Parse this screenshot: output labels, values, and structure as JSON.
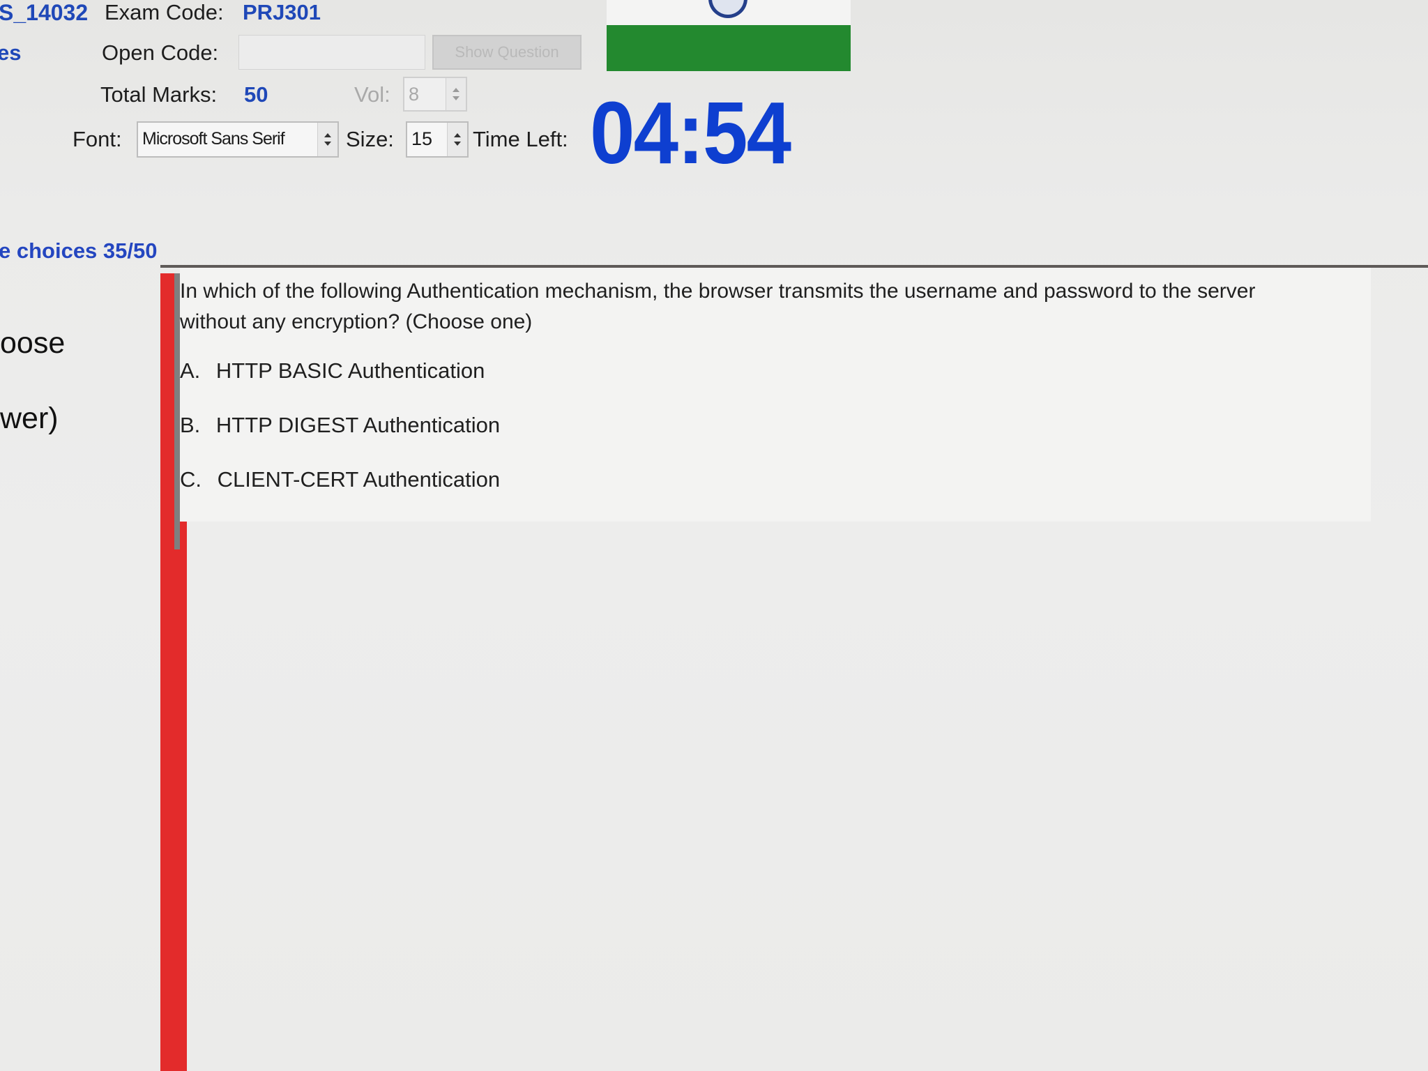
{
  "header": {
    "student_id": "S_14032",
    "exam_code_label": "Exam Code:",
    "exam_code": "PRJ301",
    "left_partial_label": "es",
    "open_code_label": "Open Code:",
    "open_code_value": "",
    "show_question_button": "Show Question",
    "total_marks_label": "Total Marks:",
    "total_marks": "50",
    "vol_label": "Vol:",
    "vol_value": "8",
    "font_label": "Font:",
    "font_value": "Microsoft Sans Serif",
    "size_label": "Size:",
    "size_value": "15",
    "time_left_label": "Time Left:",
    "time_left": "04:54"
  },
  "progress": {
    "text": "e choices 35/50"
  },
  "sidebar": {
    "line1": "oose",
    "line2": "wer)"
  },
  "question": {
    "text": "In which of the following Authentication mechanism, the browser transmits the username and password to the server without any encryption? (Choose one)",
    "options": [
      {
        "letter": "A.",
        "text": "HTTP BASIC Authentication"
      },
      {
        "letter": "B.",
        "text": "HTTP DIGEST Authentication"
      },
      {
        "letter": "C.",
        "text": "CLIENT-CERT Authentication"
      }
    ]
  },
  "colors": {
    "accent_blue": "#1f48b8",
    "timer_blue": "#0e3fd0",
    "green_status": "#23892f",
    "red_marker": "#e32b2b"
  }
}
